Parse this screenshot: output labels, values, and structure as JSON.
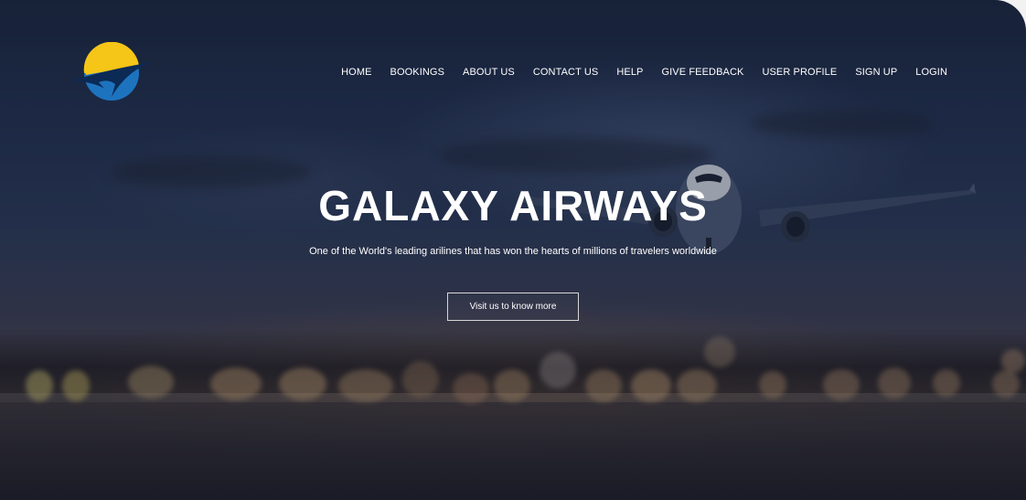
{
  "brand": {
    "logo_icon": "airline-logo-sun-swoosh",
    "colors": {
      "sun": "#f5c518",
      "globe": "#1e73be",
      "swoosh": "#0b2a55"
    }
  },
  "nav": {
    "items": [
      {
        "label": "HOME"
      },
      {
        "label": "BOOKINGS"
      },
      {
        "label": "ABOUT US"
      },
      {
        "label": "CONTACT US"
      },
      {
        "label": "HELP"
      },
      {
        "label": "GIVE FEEDBACK"
      },
      {
        "label": "USER PROFILE"
      },
      {
        "label": "SIGN UP"
      },
      {
        "label": "LOGIN"
      }
    ]
  },
  "hero": {
    "title": "GALAXY AIRWAYS",
    "subtitle": "One of the World's leading arilines that has won the hearts of millions of travelers worldwide",
    "cta_label": "Visit us to know more",
    "background_image": "airplane-landing-at-dusk-photo"
  }
}
